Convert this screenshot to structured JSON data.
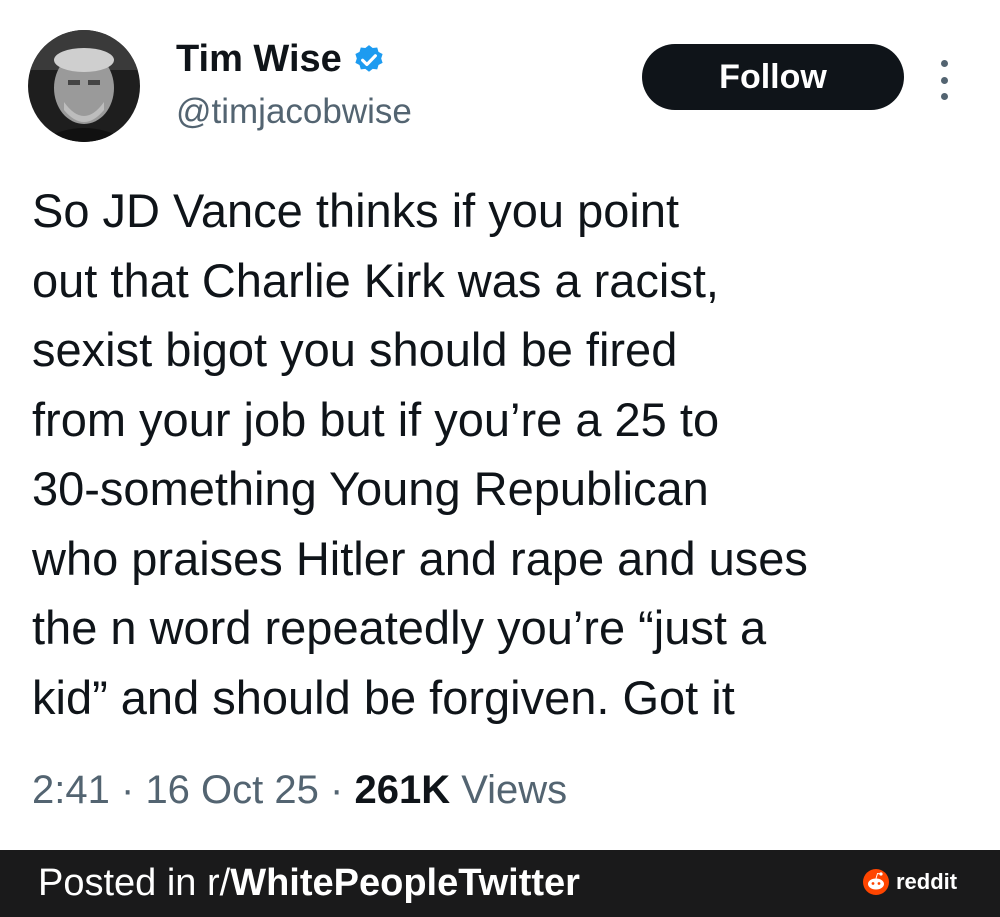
{
  "tweet": {
    "author_name": "Tim Wise",
    "handle": "@timjacobwise",
    "follow_label": "Follow",
    "text_lines": [
      "So JD Vance thinks if you point",
      "out that Charlie Kirk was a racist,",
      "sexist bigot you should be fired",
      "from your job but if you’re a 25 to",
      "30-something Young Republican",
      "who praises Hitler and rape and uses",
      "the n word repeatedly you’re “just a",
      "kid” and should be forgiven. Got it"
    ],
    "time": "2:41",
    "date": "16 Oct 25",
    "views_count": "261K",
    "views_label": "Views",
    "separator": "·",
    "verified_badge_color": "#1d9bf0"
  },
  "footer": {
    "posted_prefix": "Posted in r/",
    "subreddit": "WhitePeopleTwitter",
    "brand": "reddit",
    "brand_color": "#ff4500"
  },
  "icons": [
    "avatar-photo",
    "verified-badge-icon",
    "more-options-icon",
    "reddit-logo-icon"
  ]
}
